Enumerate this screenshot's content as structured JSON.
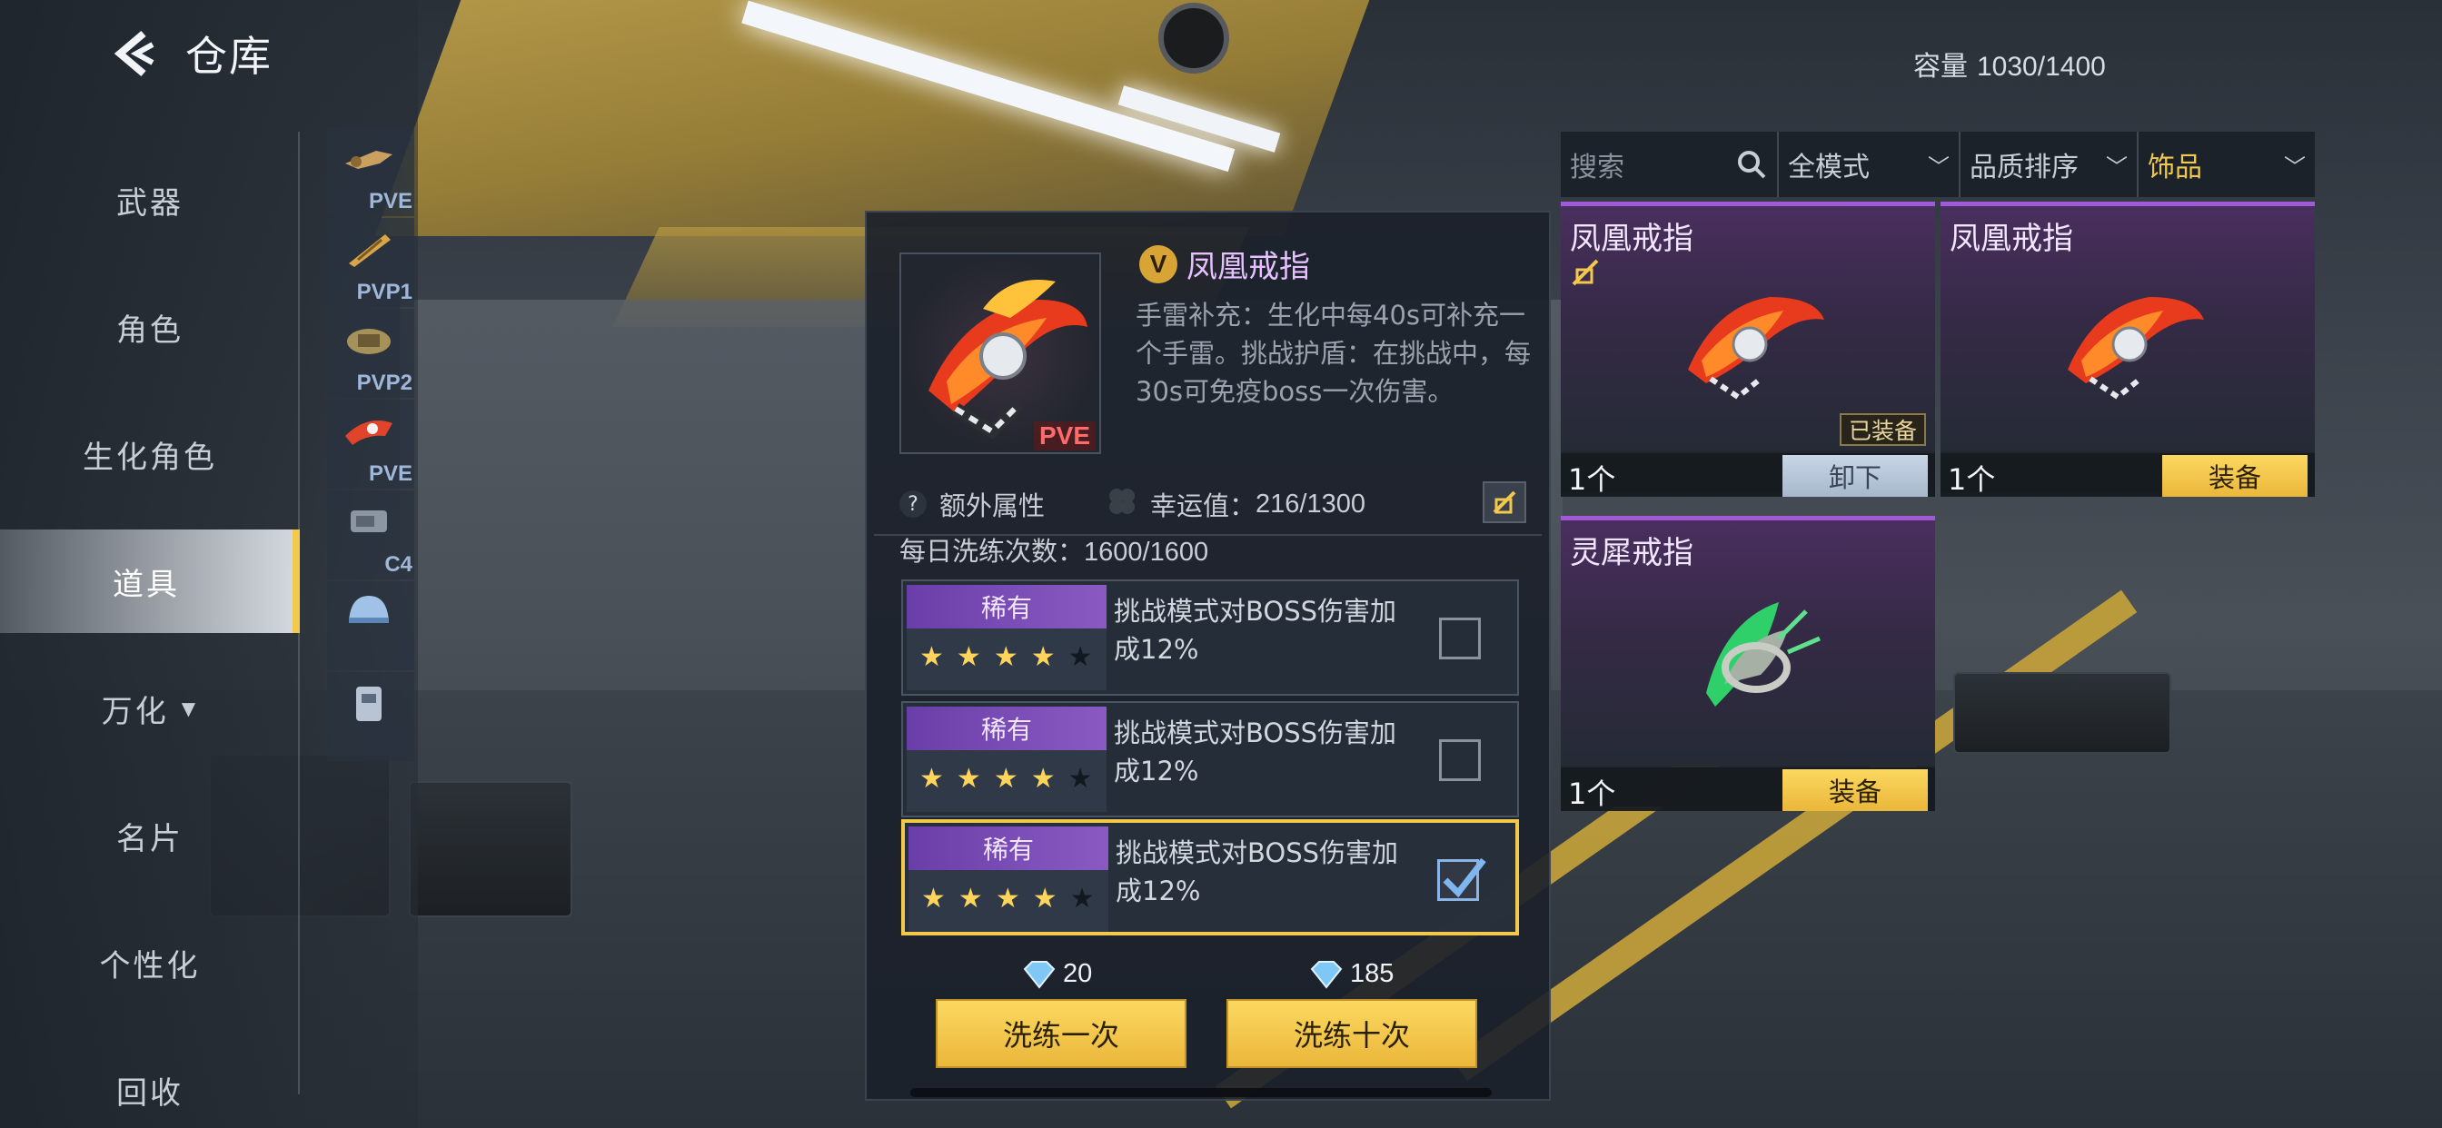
{
  "header": {
    "title": "仓库"
  },
  "capacity": {
    "label": "容量",
    "value": "1030/1400"
  },
  "nav": {
    "items": [
      {
        "label": "武器"
      },
      {
        "label": "角色"
      },
      {
        "label": "生化角色"
      },
      {
        "label": "道具",
        "active": true
      },
      {
        "label": "万化"
      },
      {
        "label": "名片"
      },
      {
        "label": "个性化"
      },
      {
        "label": "回收"
      }
    ]
  },
  "filters": [
    {
      "tag": "PVE"
    },
    {
      "tag": "PVP1"
    },
    {
      "tag": "PVP2"
    },
    {
      "tag": "PVE"
    },
    {
      "tag": "C4"
    },
    {
      "tag": ""
    },
    {
      "tag": ""
    }
  ],
  "detail": {
    "badge": "V",
    "name": "凤凰戒指",
    "thumb_tag": "PVE",
    "desc": "手雷补充：生化中每40s可补充一个手雷。挑战护盾：在挑战中，每30s可免疫boss一次伤害。",
    "extra_attr": "额外属性",
    "luck_label": "幸运值：",
    "luck_value": "216/1300",
    "daily_label": "每日洗练次数：",
    "daily_value": "1600/1600",
    "options": [
      {
        "rarity": "稀有",
        "stars": 4,
        "max_stars": 5,
        "text": "挑战模式对BOSS伤害加成12%",
        "checked": false
      },
      {
        "rarity": "稀有",
        "stars": 4,
        "max_stars": 5,
        "text": "挑战模式对BOSS伤害加成12%",
        "checked": false
      },
      {
        "rarity": "稀有",
        "stars": 4,
        "max_stars": 5,
        "text": "挑战模式对BOSS伤害加成12%",
        "checked": true
      }
    ],
    "refine_once": {
      "cost": "20",
      "label": "洗练一次"
    },
    "refine_ten": {
      "cost": "185",
      "label": "洗练十次"
    }
  },
  "filter_bar": {
    "search_placeholder": "搜索",
    "mode": "全模式",
    "sort": "品质排序",
    "category": "饰品"
  },
  "cards": [
    {
      "name": "凤凰戒指",
      "count": "1个",
      "button": "卸下",
      "equipped_tag": "已装备"
    },
    {
      "name": "凤凰戒指",
      "count": "1个",
      "button": "装备"
    },
    {
      "name": "灵犀戒指",
      "count": "1个",
      "button": "装备"
    }
  ],
  "colors": {
    "accent_gold": "#f2c94c",
    "rare_purple": "#8a5ac2",
    "item_name": "#e6c0ff"
  }
}
